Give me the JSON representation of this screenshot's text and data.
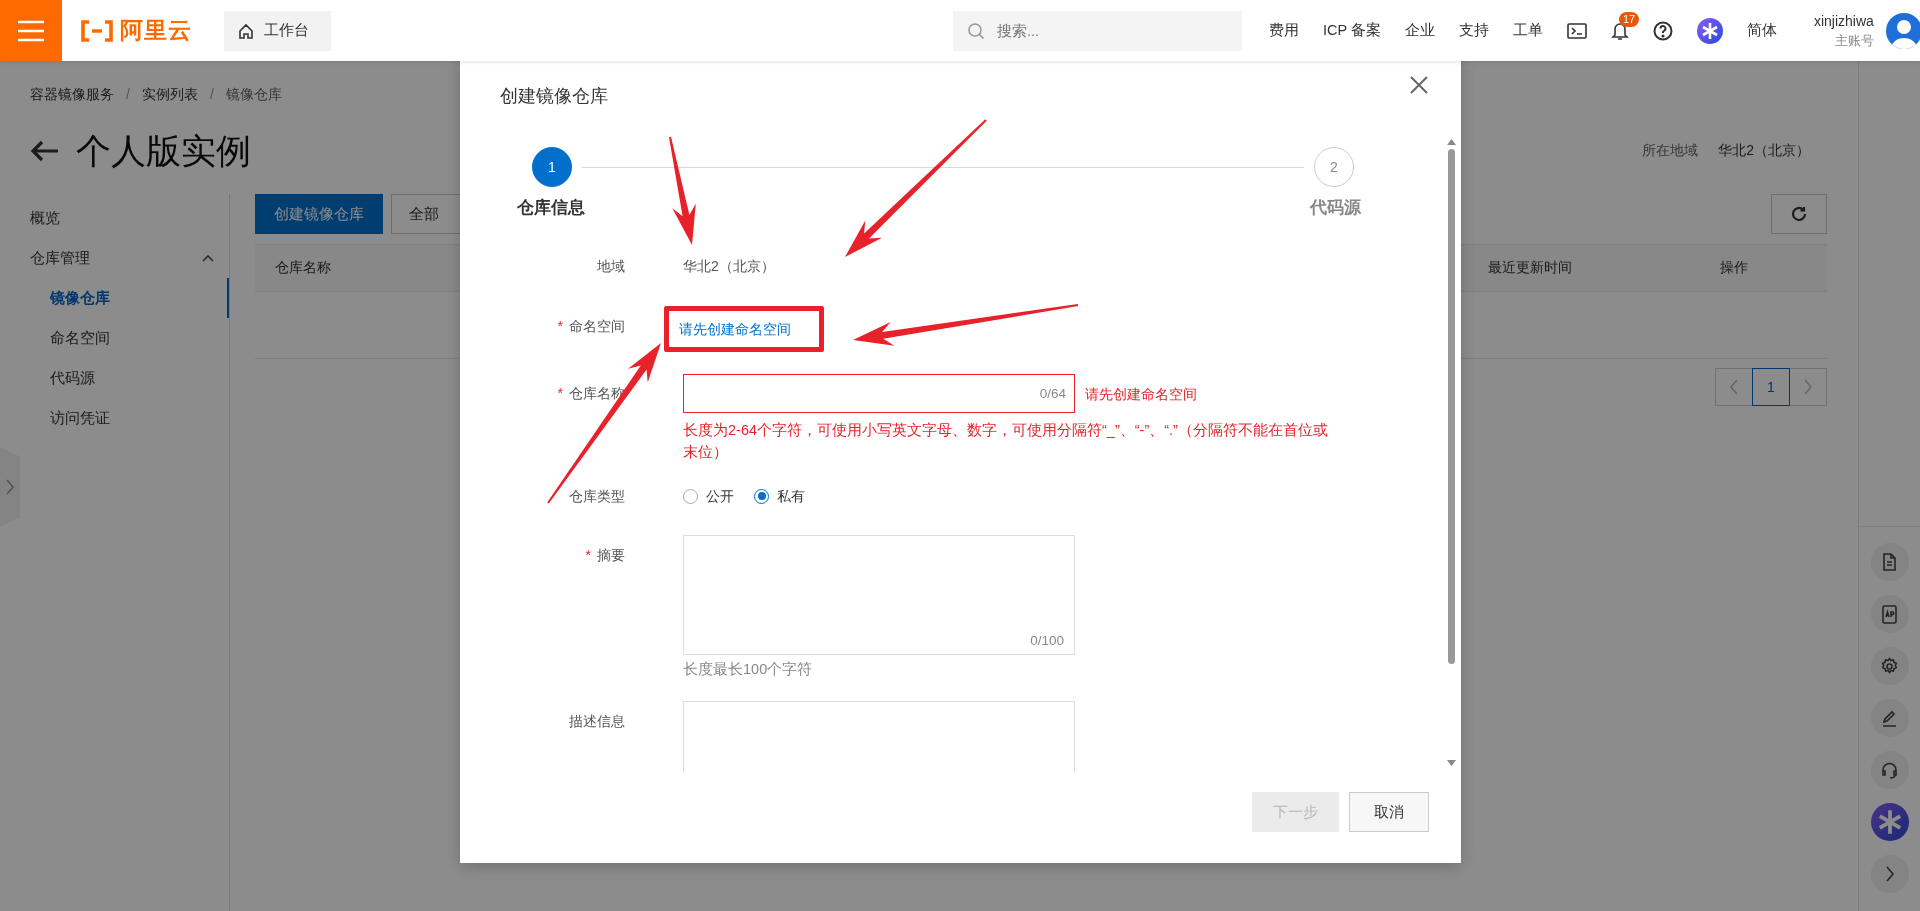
{
  "top_bar": {
    "logo_text": "阿里云",
    "workbench": "工作台",
    "search": {
      "placeholder": "搜索..."
    },
    "links": [
      "费用",
      "ICP 备案",
      "企业",
      "支持",
      "工单"
    ],
    "notification_count": "17",
    "language": "简体",
    "user": {
      "name": "xinjizhiwa",
      "role": "主账号"
    }
  },
  "breadcrumb": {
    "separator": "/",
    "items": [
      "容器镜像服务",
      "实例列表",
      "镜像仓库"
    ]
  },
  "page": {
    "title": "个人版实例",
    "region_label": "所在地域",
    "region_value": "华北2（北京）"
  },
  "sidebar": {
    "items": [
      {
        "label": "概览",
        "selected": false
      },
      {
        "label": "仓库管理",
        "selected": false,
        "expanded": true,
        "children": [
          {
            "label": "镜像仓库",
            "selected": true
          },
          {
            "label": "命名空间",
            "selected": false
          },
          {
            "label": "代码源",
            "selected": false
          },
          {
            "label": "访问凭证",
            "selected": false
          }
        ]
      }
    ]
  },
  "toolbar": {
    "buttons": [
      {
        "label": "创建镜像仓库",
        "kind": "primary"
      },
      {
        "label": "全部",
        "kind": "default"
      }
    ]
  },
  "table": {
    "columns": [
      "仓库名称",
      "最近更新时间",
      "操作"
    ]
  },
  "pagination": {
    "pages": [
      {
        "label": "1",
        "selected": true
      }
    ]
  },
  "dialog": {
    "title": "创建镜像仓库",
    "required_mark": "*",
    "steps": [
      {
        "number": "1",
        "label": "仓库信息",
        "selected": true
      },
      {
        "number": "2",
        "label": "代码源",
        "selected": false
      }
    ],
    "fields": [
      {
        "kind": "text",
        "label": "地域",
        "required": false,
        "value": "华北2（北京）"
      },
      {
        "kind": "link",
        "label": "命名空间",
        "required": true,
        "value": "请先创建命名空间"
      },
      {
        "kind": "input",
        "label": "仓库名称",
        "required": true,
        "invalid": true,
        "counter": "0/64",
        "error": "请先创建命名空间",
        "help": "长度为2-64个字符，可使用小写英文字母、数字，可使用分隔符“_”、“-”、“.”（分隔符不能在首位或末位）"
      },
      {
        "kind": "radio",
        "label": "仓库类型",
        "required": false,
        "options": [
          {
            "label": "公开",
            "selected": false
          },
          {
            "label": "私有",
            "selected": true
          }
        ]
      },
      {
        "kind": "textarea",
        "label": "摘要",
        "required": true,
        "invalid": false,
        "counter": "0/100",
        "help": "长度最长100个字符"
      },
      {
        "kind": "textarea",
        "label": "描述信息",
        "required": false,
        "invalid": false
      }
    ],
    "buttons": [
      {
        "label": "下一步",
        "kind": "primary",
        "disabled": true
      },
      {
        "label": "取消",
        "kind": "default",
        "disabled": false
      }
    ]
  }
}
